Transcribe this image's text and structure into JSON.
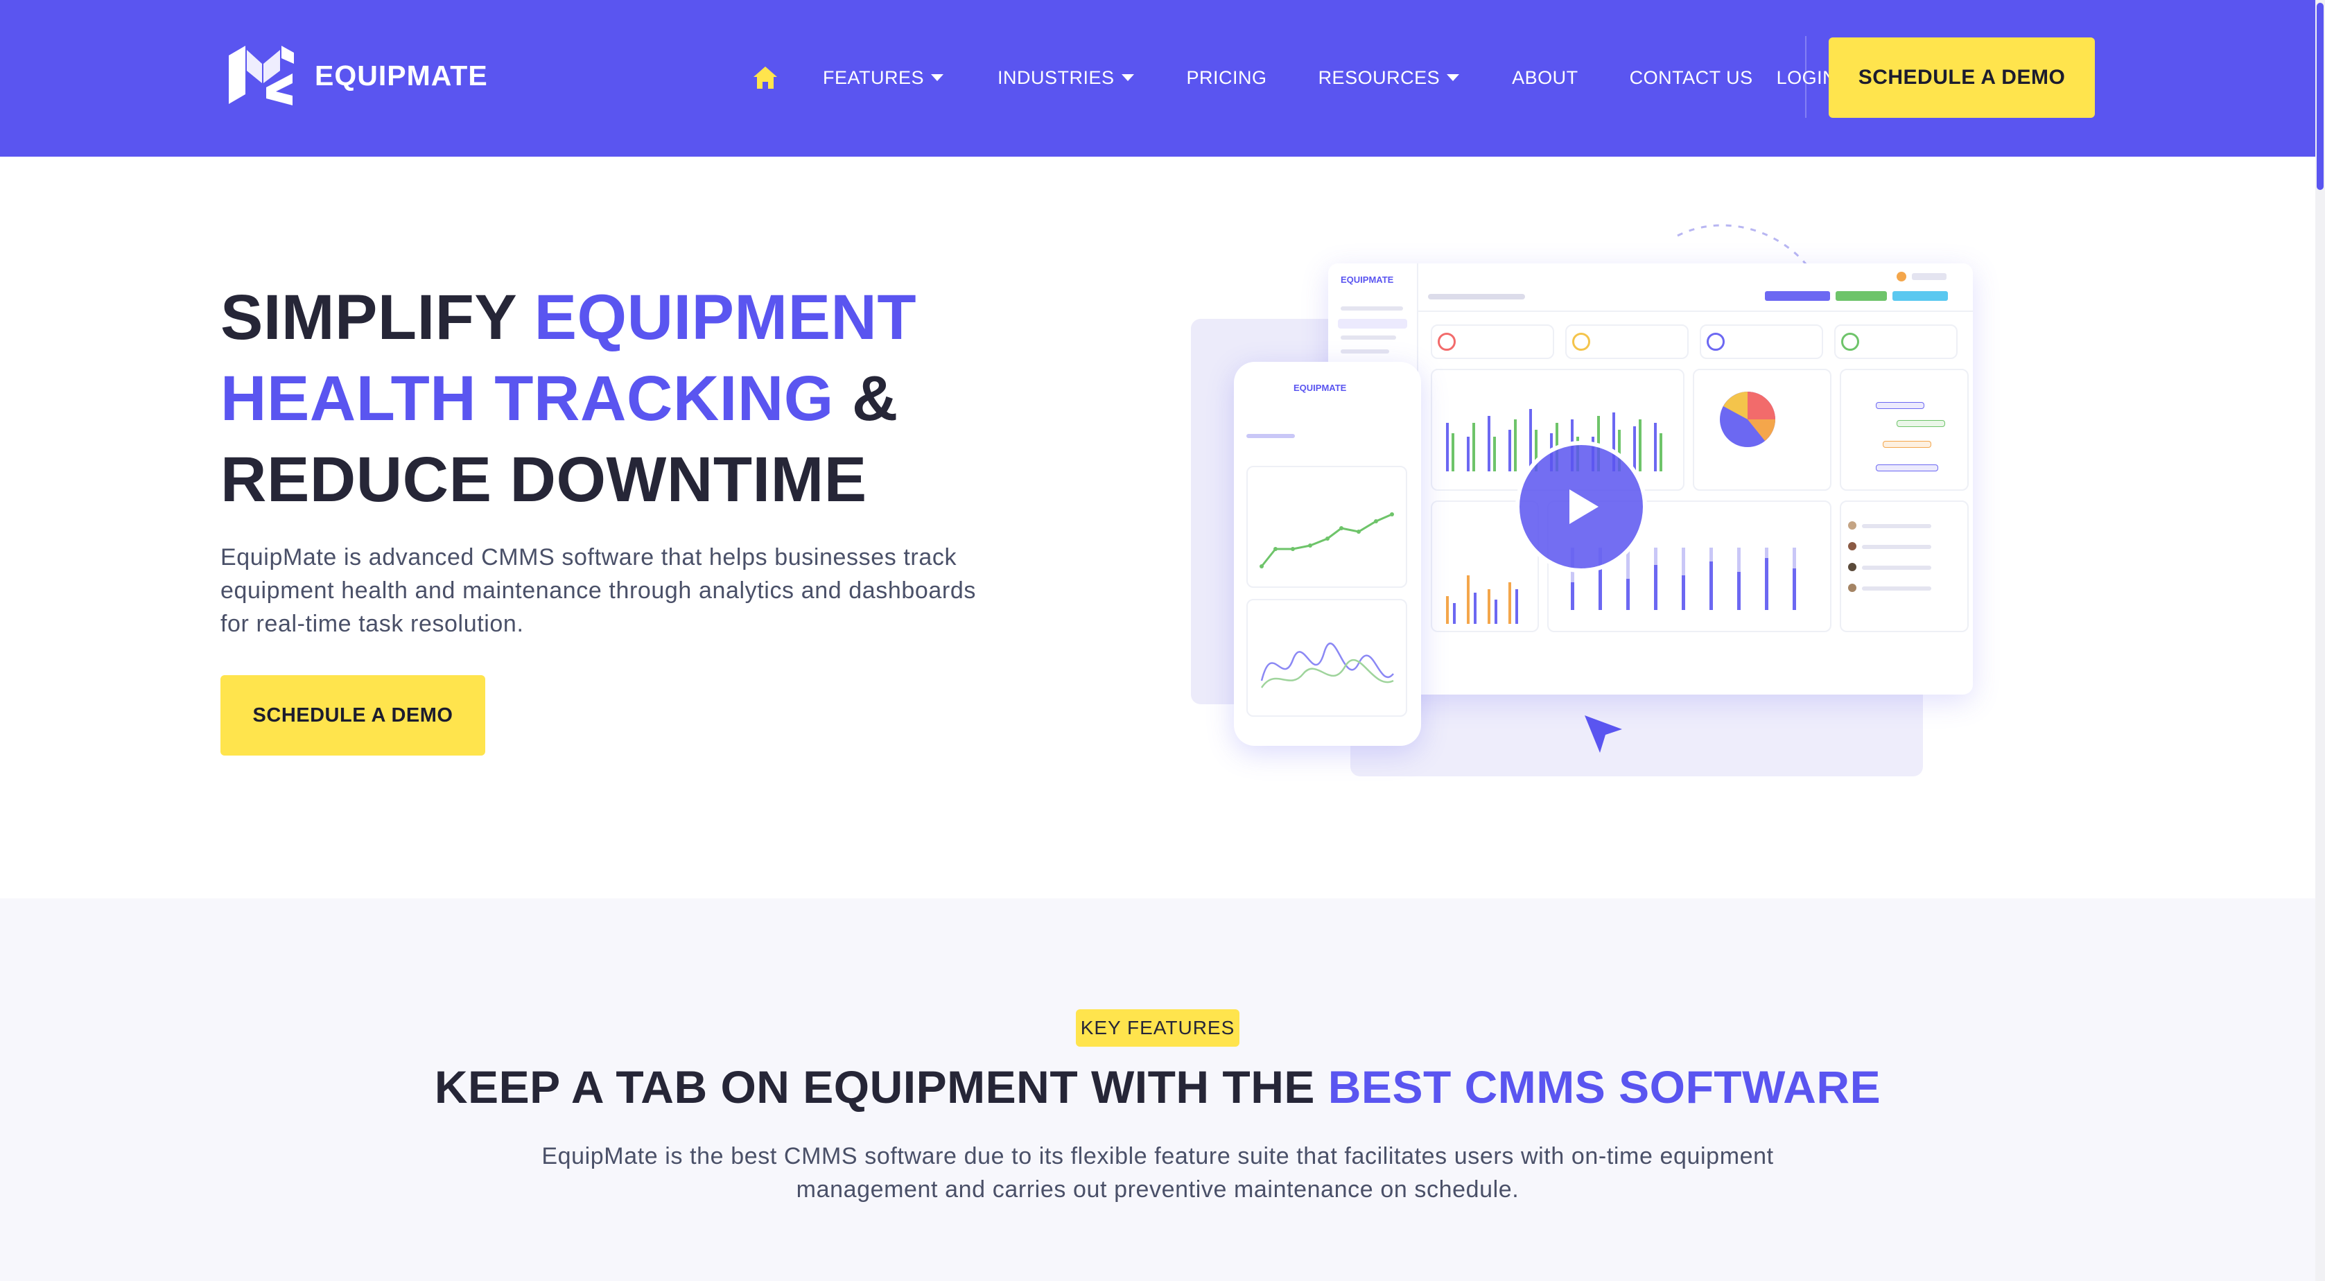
{
  "brand": {
    "name": "EQUIPMATE",
    "primary_color": "#5a55f0",
    "accent_color": "#ffe44d",
    "text_color": "#262637"
  },
  "nav": {
    "home_icon": "home-icon",
    "items": [
      {
        "label": "FEATURES",
        "dropdown": true
      },
      {
        "label": "INDUSTRIES",
        "dropdown": true
      },
      {
        "label": "PRICING",
        "dropdown": false
      },
      {
        "label": "RESOURCES",
        "dropdown": true
      },
      {
        "label": "ABOUT",
        "dropdown": false
      },
      {
        "label": "CONTACT US",
        "dropdown": false
      },
      {
        "label": "LOGIN",
        "dropdown": false
      }
    ],
    "cta_label": "SCHEDULE A DEMO"
  },
  "hero": {
    "title_line1_plain": "SIMPLIFY ",
    "title_line1_accent": "EQUIPMENT",
    "title_line2_accent": "HEALTH TRACKING",
    "title_line2_plain": " &",
    "title_line3_plain": "REDUCE DOWNTIME",
    "description": "EquipMate is advanced CMMS software that helps businesses track equipment health and maintenance through analytics and dashboards for real-time task resolution.",
    "cta_label": "SCHEDULE A DEMO"
  },
  "mockup": {
    "desktop_logo": "EQUIPMATE",
    "phone_logo": "EQUIPMATE",
    "play_icon": "play-icon",
    "cursor_icon": "cursor-arrow-icon"
  },
  "features": {
    "badge": "KEY FEATURES",
    "title_plain": "KEEP A TAB ON EQUIPMENT WITH THE ",
    "title_accent": "BEST CMMS SOFTWARE",
    "description": "EquipMate is the best CMMS software due to its flexible feature suite that facilitates users with on-time equipment management and carries out preventive maintenance on schedule."
  }
}
